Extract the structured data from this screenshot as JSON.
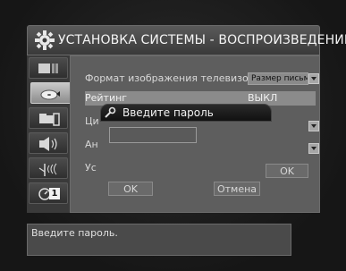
{
  "header": {
    "title": "УСТАНОВКА СИСТЕМЫ - ВОСПРОИЗВЕДЕНИЕ",
    "icon": "gear-icon"
  },
  "sidebar": {
    "items": [
      {
        "icon": "display-settings-icon"
      },
      {
        "icon": "disc-play-icon",
        "active": true
      },
      {
        "icon": "video-camera-icon"
      },
      {
        "icon": "speaker-audio-icon"
      },
      {
        "icon": "antenna-signal-icon"
      },
      {
        "icon": "timer-icon",
        "badge": "1"
      }
    ]
  },
  "settings": {
    "tv_format_label": "Формат изображения телевизора",
    "tv_format_value": "Размер письма",
    "rating_label": "Рейтинг",
    "rating_value": "ВЫКЛ",
    "row3_label": "Ци",
    "row4_label": "Ан",
    "row5_label": "Ус",
    "ok_right": "OK"
  },
  "dialog": {
    "title": "Введите пароль",
    "ok_label": "OK",
    "cancel_label": "Отмена"
  },
  "message": "Введите пароль.",
  "colors": {
    "panel": "#5e5e5e",
    "header": "#4a4a4a",
    "highlight": "#8b8b8b"
  }
}
